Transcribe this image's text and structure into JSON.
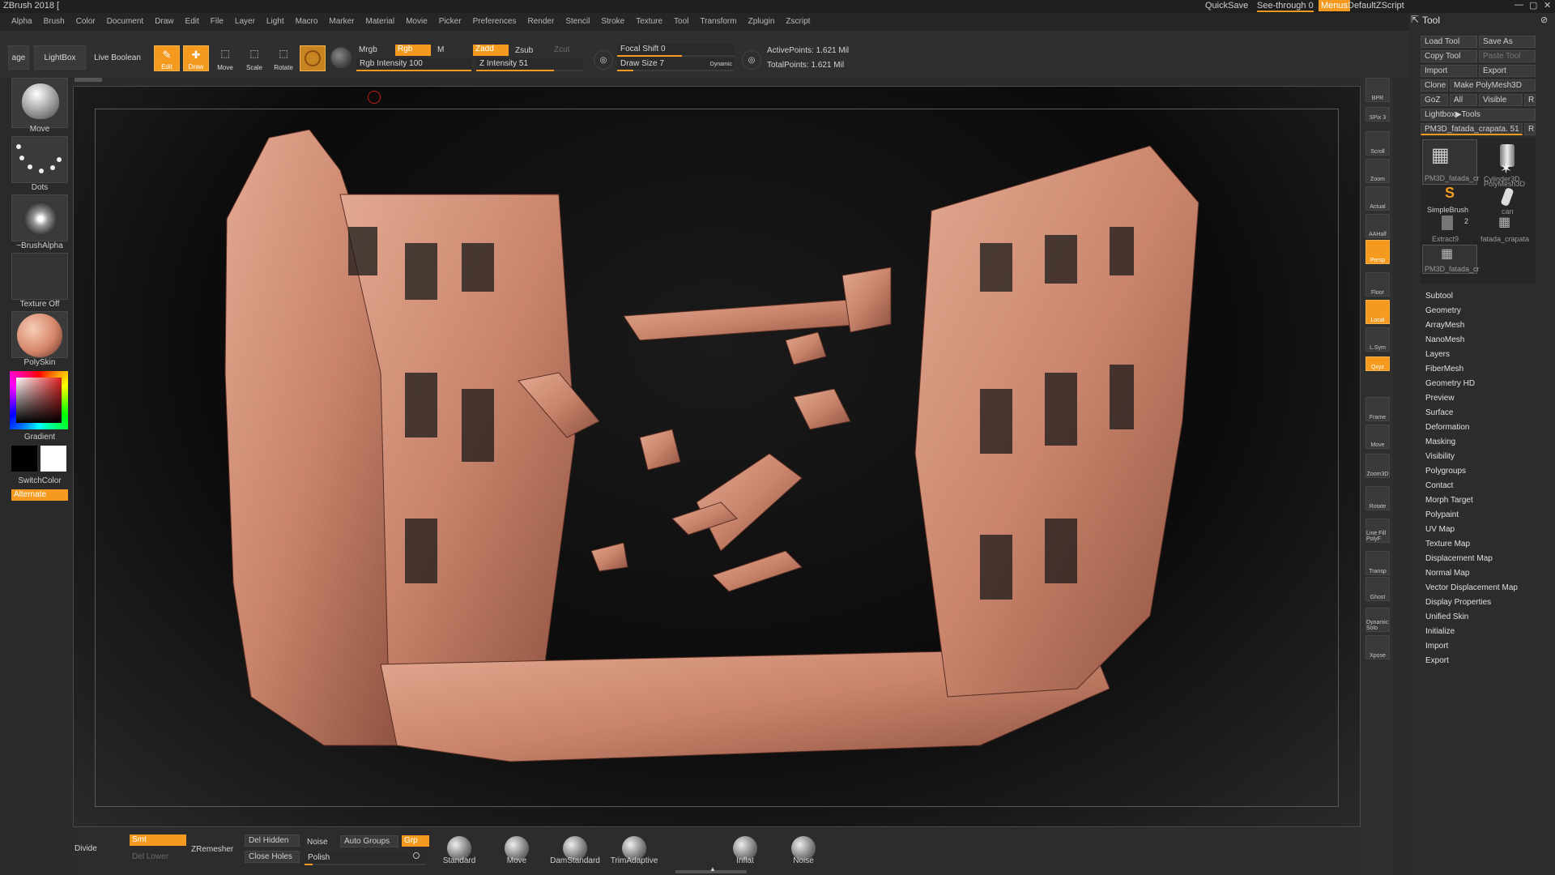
{
  "title": {
    "app": "ZBrush 2018 [",
    "quicksave": "QuickSave",
    "see_through": "See-through",
    "see_through_value": "0",
    "menus": "Menus",
    "script": "DefaultZScript"
  },
  "menus": [
    "Alpha",
    "Brush",
    "Color",
    "Document",
    "Draw",
    "Edit",
    "File",
    "Layer",
    "Light",
    "Macro",
    "Marker",
    "Material",
    "Movie",
    "Picker",
    "Preferences",
    "Render",
    "Stencil",
    "Stroke",
    "Texture",
    "Tool",
    "Transform",
    "Zplugin",
    "Zscript"
  ],
  "shelf": {
    "age": "age",
    "lightbox": "LightBox",
    "live_boolean": "Live Boolean",
    "edit": "Edit",
    "draw": "Draw",
    "move": "Move",
    "scale": "Scale",
    "rotate": "Rotate",
    "mrgb": "Mrgb",
    "rgb": "Rgb",
    "m": "M",
    "zadd": "Zadd",
    "zsub": "Zsub",
    "zcut": "Zcut",
    "rgb_intensity": "Rgb Intensity 100",
    "z_intensity": "Z Intensity 51",
    "focal_shift": "Focal Shift 0",
    "draw_size": "Draw Size 7",
    "dynamic": "Dynamic",
    "active_points": "ActivePoints: 1.621 Mil",
    "total_points": "TotalPoints: 1.621 Mil"
  },
  "left": {
    "move": "Move",
    "dots": "Dots",
    "brush_alpha": "~BrushAlpha",
    "texture_off": "Texture Off",
    "polyskin": "PolySkin",
    "gradient": "Gradient",
    "switchcolor": "SwitchColor",
    "alternate": "Alternate"
  },
  "right_strip": [
    "BPR",
    "SPix 3",
    "Scroll",
    "Zoom",
    "Actual",
    "AAHalf",
    "Persp",
    "Floor",
    "Local",
    "L.Sym",
    "Qxyz",
    "Frame",
    "Move",
    "Zoom3D",
    "Rotate",
    "Line Fill PolyF",
    "Transp",
    "Ghost",
    "Dynamic Solo",
    "Xpose"
  ],
  "tool": {
    "header": "Tool",
    "load_tool": "Load Tool",
    "save_as": "Save As",
    "copy_tool": "Copy Tool",
    "paste_tool": "Paste Tool",
    "import": "Import",
    "export": "Export",
    "clone": "Clone",
    "make_polymesh": "Make PolyMesh3D",
    "goz": "GoZ",
    "all": "All",
    "visible": "Visible",
    "r": "R",
    "lightbox_tools": "Lightbox▶Tools",
    "current_tool": "PM3D_fatada_crapata. 51",
    "thumbs": [
      "PM3D_fatada_cr",
      "Cylinder3D",
      "SimpleBrush",
      "PolyMesh3D",
      "Extract9",
      "can",
      "fatada_crapata",
      "PM3D_fatada_cr"
    ],
    "thumb_count": "2",
    "subpalettes": [
      "Subtool",
      "Geometry",
      "ArrayMesh",
      "NanoMesh",
      "Layers",
      "FiberMesh",
      "Geometry HD",
      "Preview",
      "Surface",
      "Deformation",
      "Masking",
      "Visibility",
      "Polygroups",
      "Contact",
      "Morph Target",
      "Polypaint",
      "UV Map",
      "Texture Map",
      "Displacement Map",
      "Normal Map",
      "Vector Displacement Map",
      "Display Properties",
      "Unified Skin",
      "Initialize",
      "Import",
      "Export"
    ]
  },
  "bottom": {
    "divide": "Divide",
    "smt": "Smt",
    "del_lower": "Del Lower",
    "zremesher": "ZRemesher",
    "del_hidden": "Del Hidden",
    "close_holes": "Close Holes",
    "noise": "Noise",
    "auto_groups": "Auto Groups",
    "grp": "Grp",
    "polish": "Polish",
    "brushes": [
      "Standard",
      "Move",
      "DamStandard",
      "TrimAdaptive",
      "Inflat",
      "Noise"
    ]
  }
}
